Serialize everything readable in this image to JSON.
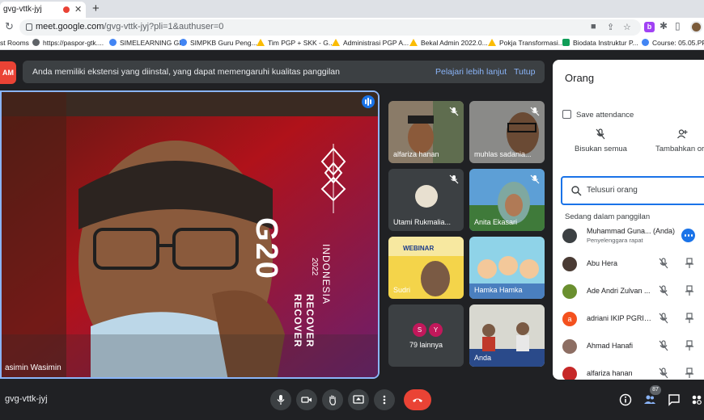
{
  "browser": {
    "tab_title": "gvg-vttk-jyj",
    "url_host": "meet.google.com",
    "url_path": "/gvg-vttk-jyj?pli=1&authuser=0",
    "bookmarks": [
      {
        "label": "st Rooms",
        "icon": "none"
      },
      {
        "label": "https://paspor-gtk....",
        "icon": "globe"
      },
      {
        "label": "SIMELEARNING GP",
        "icon": "blue"
      },
      {
        "label": "SIMPKB Guru Peng...",
        "icon": "blue"
      },
      {
        "label": "Tim PGP + SKK - G...",
        "icon": "drive"
      },
      {
        "label": "Administrasi PGP A...",
        "icon": "drive"
      },
      {
        "label": "Bekal Admin 2022.0...",
        "icon": "drive"
      },
      {
        "label": "Pokja Transformasi...",
        "icon": "drive"
      },
      {
        "label": "Biodata Instruktur P...",
        "icon": "sheets"
      },
      {
        "label": "Course: 05.05.PPPP",
        "icon": "blue"
      }
    ]
  },
  "banner": {
    "left_label": "AM",
    "text": "Anda memiliki ekstensi yang diinstal, yang dapat memengaruhi kualitas panggilan",
    "learn_more": "Pelajari lebih lanjut",
    "close": "Tutup"
  },
  "main_tile": {
    "name": "asimin Wasimin",
    "backdrop": {
      "g20": "G20",
      "country": "INDONESIA",
      "year": "2022",
      "recover": "RECOVER"
    }
  },
  "tiles": [
    {
      "name": "alfariza hanan"
    },
    {
      "name": "muhlas sadania..."
    },
    {
      "name": "Utami Rukmalia..."
    },
    {
      "name": "Anita Ekasari"
    },
    {
      "name": "Sudri",
      "caption": "WEBINAR"
    },
    {
      "name": "Hamka Hamka"
    },
    {
      "name": "79 lainnya",
      "avatars": [
        "S",
        "Y"
      ]
    },
    {
      "name": "Anda"
    }
  ],
  "people_panel": {
    "title": "Orang",
    "save_attendance": "Save attendance",
    "mute_all": "Bisukan semua",
    "add_people": "Tambahkan ora",
    "search_placeholder": "Telusuri orang",
    "section": "Sedang dalam panggilan",
    "people": [
      {
        "name": "Muhammad Guna...",
        "you": "(Anda)",
        "role": "Penyelenggara rapat",
        "avatar_color": "#3c4043",
        "initial": ""
      },
      {
        "name": "Abu Hera",
        "avatar_color": "#4a3b34",
        "initial": ""
      },
      {
        "name": "Ade Andri Zulvan ...",
        "avatar_color": "#6a8f2f",
        "initial": ""
      },
      {
        "name": "adriani IKIP PGRI ...",
        "avatar_color": "#f4511e",
        "initial": "a"
      },
      {
        "name": "Ahmad Hanafi",
        "avatar_color": "#8d6e63",
        "initial": ""
      },
      {
        "name": "alfariza hanan",
        "avatar_color": "#c62828",
        "initial": ""
      }
    ]
  },
  "bottom_bar": {
    "meeting_code": "gvg-vttk-jyj",
    "participant_count": "87"
  },
  "colors": {
    "accent": "#8ab4f8",
    "end_call": "#ea4335",
    "surface": "#202124"
  }
}
